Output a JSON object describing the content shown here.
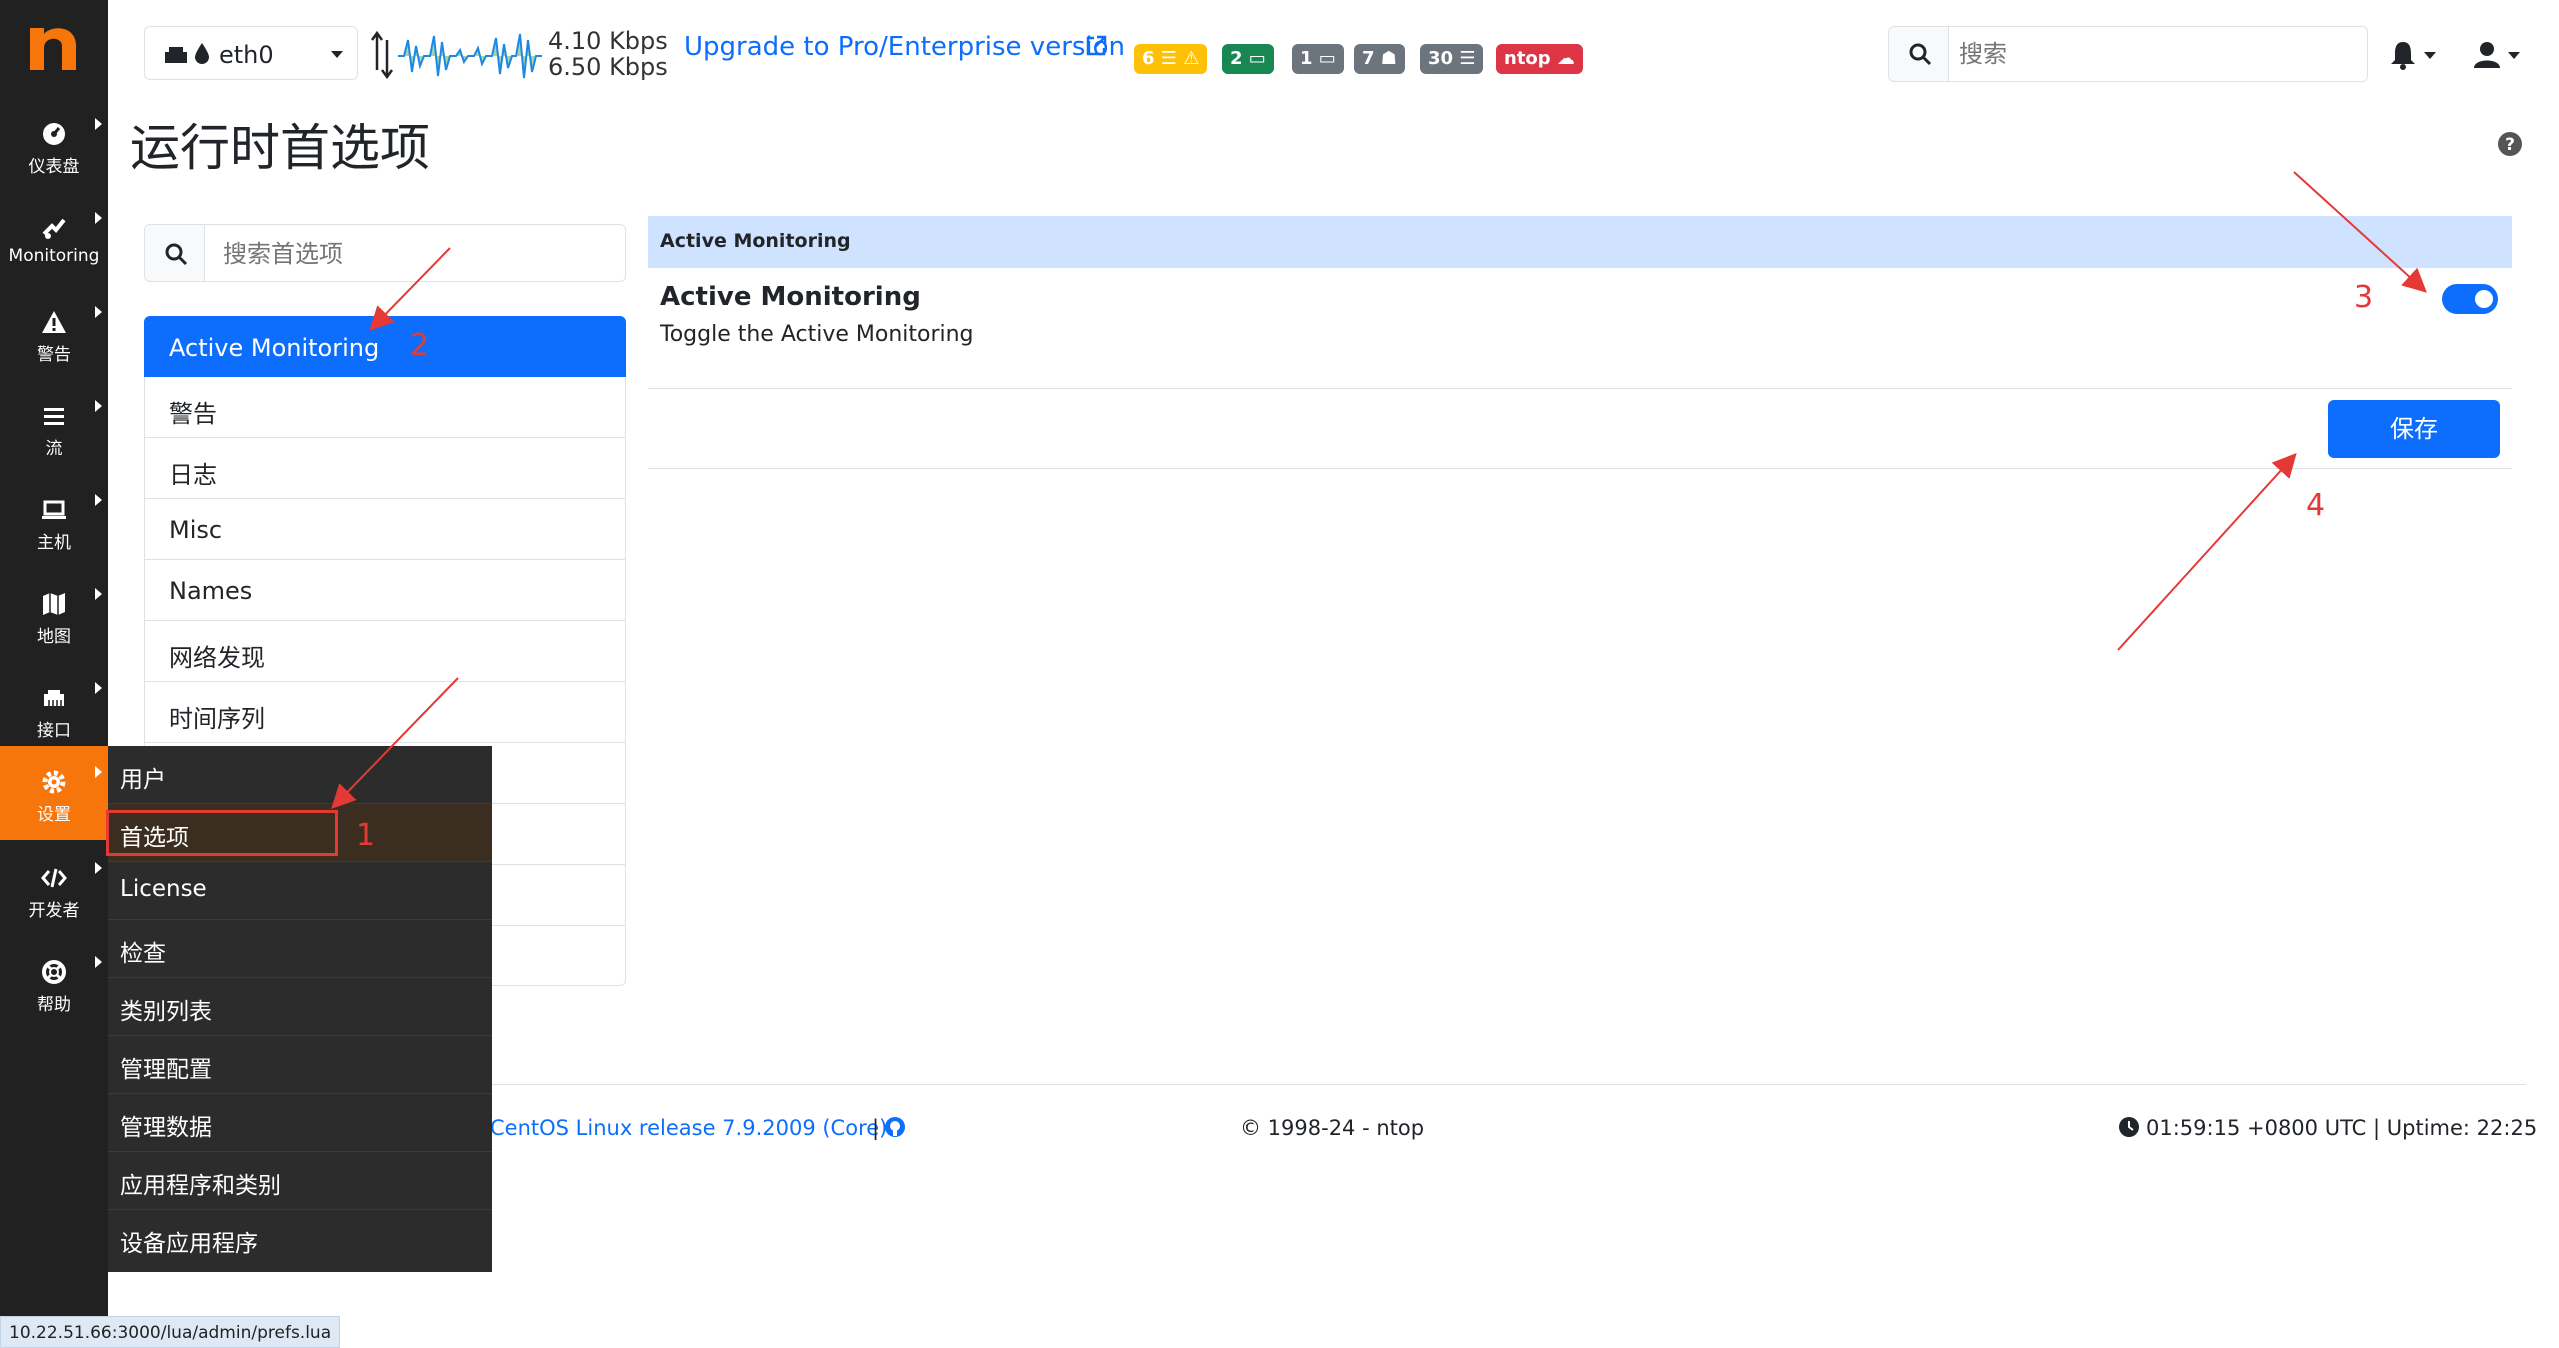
{
  "header": {
    "interface_name": "eth0",
    "rate_up": "4.10 Kbps",
    "rate_down": "6.50 Kbps",
    "upgrade_link": "Upgrade to Pro/Enterprise version",
    "badges": [
      {
        "text": "6 ☰ ⚠",
        "color": "#ffc107"
      },
      {
        "text": "2 ▭",
        "color": "#198754"
      },
      {
        "text": "1 ▭",
        "color": "#6c757d"
      },
      {
        "text": "7 ☗",
        "color": "#6c757d"
      },
      {
        "text": "30 ☰",
        "color": "#6c757d"
      },
      {
        "text": "ntop ☁",
        "color": "#dc3545"
      }
    ],
    "search_placeholder": "搜索"
  },
  "sidebar": {
    "items": [
      {
        "label": "仪表盘",
        "icon": "dashboard-icon"
      },
      {
        "label": "Monitoring",
        "icon": "monitoring-icon"
      },
      {
        "label": "警告",
        "icon": "alert-icon"
      },
      {
        "label": "流",
        "icon": "flows-icon"
      },
      {
        "label": "主机",
        "icon": "hosts-icon"
      },
      {
        "label": "地图",
        "icon": "map-icon"
      },
      {
        "label": "接口",
        "icon": "interface-icon"
      },
      {
        "label": "设置",
        "icon": "gear-icon"
      },
      {
        "label": "开发者",
        "icon": "code-icon"
      },
      {
        "label": "帮助",
        "icon": "lifering-icon"
      }
    ]
  },
  "page": {
    "title": "运行时首选项",
    "pref_search_placeholder": "搜索首选项"
  },
  "pref_list": [
    "Active Monitoring",
    "警告",
    "日志",
    "Misc",
    "Names",
    "网络发现",
    "时间序列"
  ],
  "panel": {
    "header": "Active Monitoring",
    "pref_title": "Active Monitoring",
    "pref_desc": "Toggle the Active Monitoring",
    "toggle_on": true,
    "save_label": "保存"
  },
  "submenu": [
    "用户",
    "首选项",
    "License",
    "检查",
    "类别列表",
    "管理配置",
    "管理数据",
    "应用程序和类别",
    "设备应用程序"
  ],
  "footer": {
    "os": "CentOS Linux release 7.9.2009 (Core)",
    "sep": "|",
    "copyright": "© 1998-24 - ntop",
    "time": "01:59:15 +0800 UTC | Uptime: 22:25"
  },
  "statusbar": "10.22.51.66:3000/lua/admin/prefs.lua",
  "annotations": [
    "1",
    "2",
    "3",
    "4"
  ],
  "colors": {
    "accent": "#0d6efd",
    "sidebar": "#212121",
    "active_sidebar": "#f7760b",
    "annotation": "#e53935"
  }
}
